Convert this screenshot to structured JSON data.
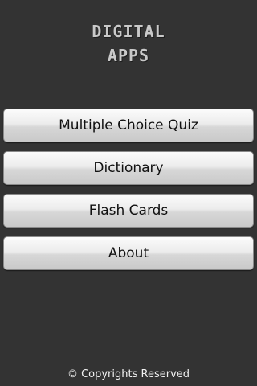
{
  "logo": {
    "line1": "DIGITAL",
    "line2": "APPS"
  },
  "menu": {
    "items": [
      {
        "label": "Multiple Choice Quiz"
      },
      {
        "label": "Dictionary"
      },
      {
        "label": "Flash Cards"
      },
      {
        "label": "About"
      }
    ]
  },
  "footer": {
    "text": "© Copyrights Reserved"
  },
  "colors": {
    "background": "#333333",
    "button_top": "#fbfbfb",
    "button_bottom": "#c9c9c9",
    "footer_text": "#f2f2f2"
  }
}
